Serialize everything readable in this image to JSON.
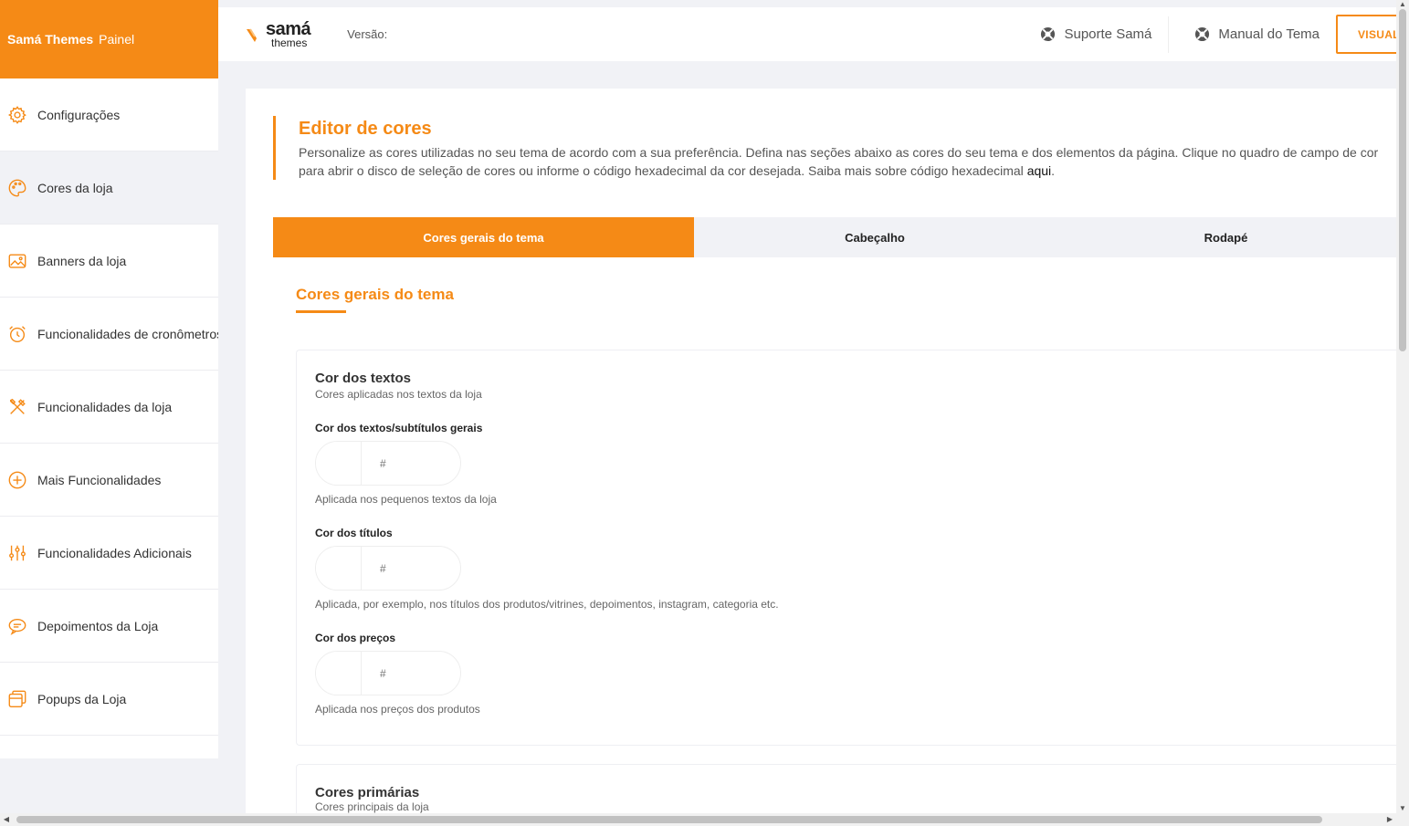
{
  "sidebar": {
    "brand_bold": "Samá Themes",
    "brand_light": "Painel",
    "items": [
      {
        "label": "Configurações"
      },
      {
        "label": "Cores da loja"
      },
      {
        "label": "Banners da loja"
      },
      {
        "label": "Funcionalidades de cronômetros"
      },
      {
        "label": "Funcionalidades da loja"
      },
      {
        "label": "Mais Funcionalidades"
      },
      {
        "label": "Funcionalidades Adicionais"
      },
      {
        "label": "Depoimentos da Loja"
      },
      {
        "label": "Popups da Loja"
      }
    ]
  },
  "topbar": {
    "logo_main": "samá",
    "logo_sub": "themes",
    "version_label": "Versão:",
    "support_label": "Suporte Samá",
    "manual_label": "Manual do Tema",
    "visualize_label": "VISUALIZAR"
  },
  "header": {
    "title": "Editor de cores",
    "description": "Personalize as cores utilizadas no seu tema de acordo com a sua preferência. Defina nas seções abaixo as cores do seu tema e dos elementos da página. Clique no quadro de campo de cor para abrir o disco de seleção de cores ou informe o código hexadecimal da cor desejada. Saiba mais sobre código hexadecimal",
    "link": "aqui",
    "period": "."
  },
  "tabs": [
    {
      "label": "Cores gerais do tema"
    },
    {
      "label": "Cabeçalho"
    },
    {
      "label": "Rodapé"
    }
  ],
  "section": {
    "title": "Cores gerais do tema"
  },
  "groups": {
    "texts": {
      "title": "Cor dos textos",
      "subtitle": "Cores aplicadas nos textos da loja",
      "fields": [
        {
          "label": "Cor dos textos/subtítulos gerais",
          "placeholder": "#",
          "value": "",
          "help": "Aplicada nos pequenos textos da loja"
        },
        {
          "label": "Cor dos títulos",
          "placeholder": "#",
          "value": "",
          "help": "Aplicada, por exemplo, nos títulos dos produtos/vitrines, depoimentos, instagram, categoria etc."
        },
        {
          "label": "Cor dos preços",
          "placeholder": "#",
          "value": "",
          "help": "Aplicada nos preços dos produtos"
        }
      ]
    },
    "primary": {
      "title": "Cores primárias",
      "subtitle": "Cores principais da loja"
    }
  },
  "colors": {
    "accent": "#f58a16",
    "background": "#f1f2f6"
  }
}
